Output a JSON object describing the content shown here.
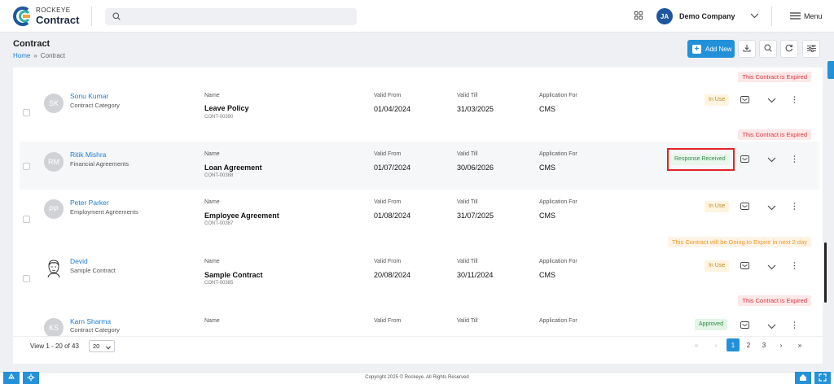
{
  "app": {
    "logo_top": "ROCKEYE",
    "logo_bottom": "Contract",
    "brand_color": "#2391d9"
  },
  "topnav": {
    "search_placeholder": "",
    "avatar_initials": "JA",
    "company": "Demo Company",
    "menu_label": "Menu"
  },
  "header": {
    "title": "Contract",
    "breadcrumb": [
      "Home",
      "Contract"
    ],
    "breadcrumb_sep": "»",
    "add_new": "Add New"
  },
  "columns": {
    "name": "Name",
    "valid_from": "Valid From",
    "valid_till": "Valid Till",
    "application_for": "Application For"
  },
  "notices": {
    "expired": "This Contract is Expired",
    "expiring": "This Contract will be Going to Expire in next 2 day"
  },
  "rows": [
    {
      "initials": "SK",
      "person": "Sonu Kumar",
      "category": "Contract Category",
      "name": "Leave Policy",
      "code": "CONT-00390",
      "valid_from": "01/04/2024",
      "valid_till": "31/03/2025",
      "application_for": "CMS",
      "status": "In Use"
    },
    {
      "initials": "RM",
      "person": "Ritik Mishra",
      "category": "Financial Agreements",
      "name": "Loan Agreement",
      "code": "CONT-00388",
      "valid_from": "01/07/2024",
      "valid_till": "30/06/2026",
      "application_for": "CMS",
      "status": "Response Received"
    },
    {
      "initials": "PP",
      "person": "Peter Parker",
      "category": "Employment Agreements",
      "name": "Employee Agreement",
      "code": "CONT-00387",
      "valid_from": "01/08/2024",
      "valid_till": "31/07/2025",
      "application_for": "CMS",
      "status": "In Use"
    },
    {
      "initials": "",
      "person": "Devid",
      "category": "Sample Contract",
      "name": "Sample Contract",
      "code": "CONT-00385",
      "valid_from": "20/08/2024",
      "valid_till": "30/11/2024",
      "application_for": "CMS",
      "status": "In Use"
    },
    {
      "initials": "KS",
      "person": "Karn Sharma",
      "category": "Contract Category",
      "name": "",
      "code": "",
      "valid_from": "",
      "valid_till": "",
      "application_for": "",
      "status": "Approved"
    }
  ],
  "pagination": {
    "view_info": "View 1 - 20 of 43",
    "page_size": "20",
    "pages": [
      "1",
      "2",
      "3"
    ],
    "current": "1"
  },
  "footer": {
    "copyright": "Copyright 2025 © Rockeye. All Rights Reserved"
  },
  "icons": {
    "search": "search-icon",
    "apps": "apps-grid-icon",
    "chevron": "chevron-down-icon",
    "menu": "hamburger-icon",
    "download": "download-icon",
    "refresh": "refresh-icon",
    "filter": "filter-icon",
    "mail": "mail-icon",
    "more": "more-vertical-icon"
  }
}
